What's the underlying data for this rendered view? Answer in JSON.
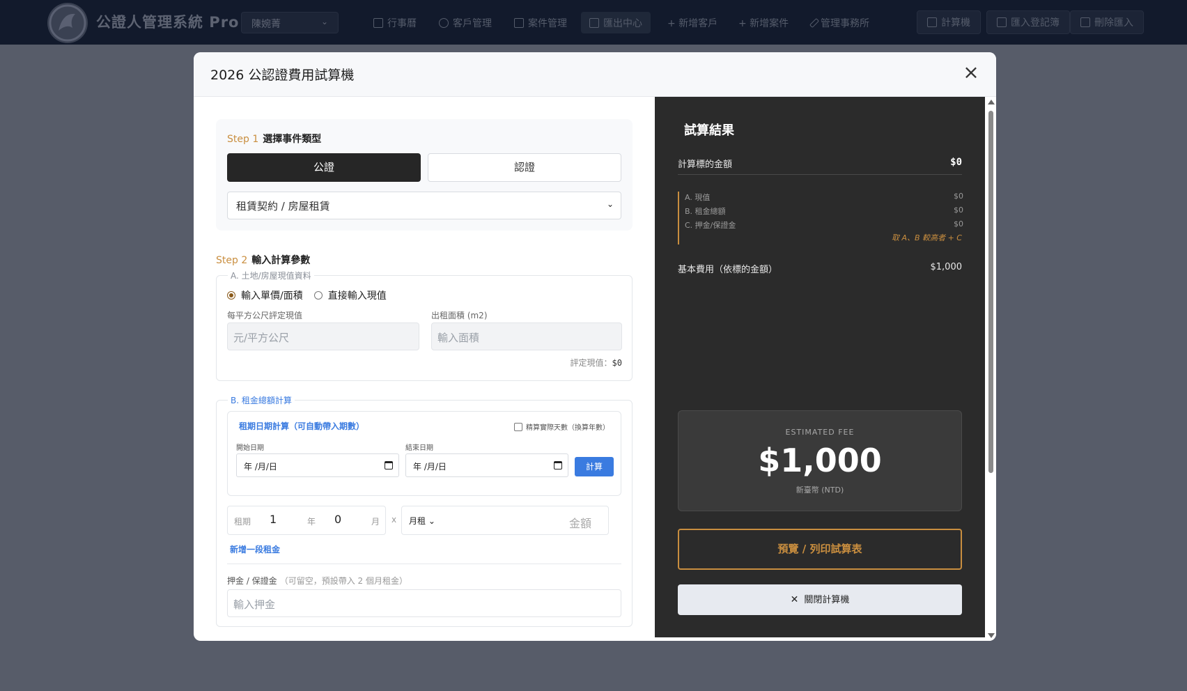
{
  "nav": {
    "brand": "公證人管理系統 Pro",
    "user": "陳婉菁",
    "items": [
      {
        "label": "行事曆",
        "icon": "calendar-icon"
      },
      {
        "label": "客戶管理",
        "icon": "users-icon"
      },
      {
        "label": "案件管理",
        "icon": "file-search-icon"
      },
      {
        "label": "匯出中心",
        "icon": "download-icon"
      },
      {
        "label": "+ 新增客戶"
      },
      {
        "label": "+ 新增案件"
      },
      {
        "label": "管理事務所",
        "icon": "pen-icon"
      }
    ],
    "buttons": [
      {
        "label": "計算機",
        "icon": "calculator-icon"
      },
      {
        "label": "匯入登記簿",
        "icon": "table-icon"
      },
      {
        "label": "刪除匯入",
        "icon": "trash-icon"
      }
    ]
  },
  "modal": {
    "title": "2026 公認證費用試算機",
    "close": "×"
  },
  "step1": {
    "num": "Step 1",
    "title": "選擇事件類型",
    "tab_public": "公證",
    "tab_cert": "認證",
    "type_value": "租賃契約 / 房屋租賃"
  },
  "step2": {
    "num": "Step 2",
    "title": "輸入計算參數",
    "sectionA": {
      "legend": "A. 土地/房屋現值資料",
      "radio1": "輸入單價/面積",
      "radio2": "直接輸入現值",
      "unit_price_label": "每平方公尺評定現值",
      "unit_price_placeholder": "元/平方公尺",
      "area_label": "出租面積 (m2)",
      "area_placeholder": "輸入面積",
      "assessed_label": "評定現值：",
      "assessed_value": "$0"
    },
    "sectionB": {
      "legend": "B. 租金總額計算",
      "date_title": "租期日期計算（可自動帶入期數）",
      "exact_days_label": "精算實際天數（換算年數）",
      "start_label": "開始日期",
      "end_label": "結束日期",
      "date_placeholder": "年 /月/日",
      "calc_btn": "計算",
      "period_label": "租期",
      "years": "1",
      "year_unit": "年",
      "months": "0",
      "month_unit": "月",
      "x": "x",
      "mode": "月租",
      "amount_placeholder": "金額",
      "add_rent": "新增一段租金",
      "deposit_label": "押金 / 保證金",
      "deposit_hint": "（可留空，預設帶入 2 個月租金）",
      "deposit_placeholder": "輸入押金"
    }
  },
  "result": {
    "title": "試算結果",
    "target_label": "計算標的金額",
    "target_value": "$0",
    "breakdown": [
      {
        "label": "A. 現值",
        "value": "$0"
      },
      {
        "label": "B. 租金總額",
        "value": "$0"
      },
      {
        "label": "C. 押金/保證金",
        "value": "$0"
      }
    ],
    "formula_note": "取 A、B 較高者 + C",
    "base_label": "基本費用（依標的金額）",
    "base_value": "$1,000",
    "fee_caption": "ESTIMATED FEE",
    "fee_amount": "$1,000",
    "fee_unit": "新臺幣 (NTD)",
    "print_btn": "預覽 / 列印試算表",
    "close_btn": "關閉計算機"
  },
  "colors": {
    "accent_gold": "#c98e3f",
    "accent_blue": "#3a7be0",
    "panel_dark": "#2b2b2b"
  }
}
